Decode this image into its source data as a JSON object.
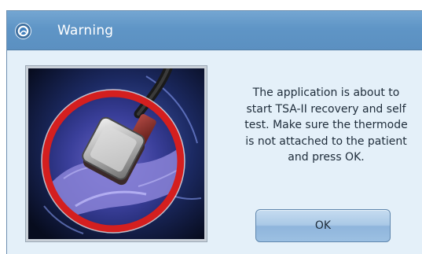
{
  "window": {
    "title": "Warning",
    "icon": "app-logo-icon"
  },
  "message": {
    "lines": [
      "The application is about to",
      "start TSA-II recovery and self",
      "test. Make sure the thermode",
      "is not attached to the patient",
      "and press OK."
    ]
  },
  "illustration": {
    "subject": "thermode-on-hand-image",
    "ring_color": "#d41f1f"
  },
  "buttons": {
    "ok_label": "OK"
  },
  "colors": {
    "titlebar": "#5f95c6",
    "dialog_bg": "#e4f0f9",
    "button_bg": "#a9c8e6"
  }
}
